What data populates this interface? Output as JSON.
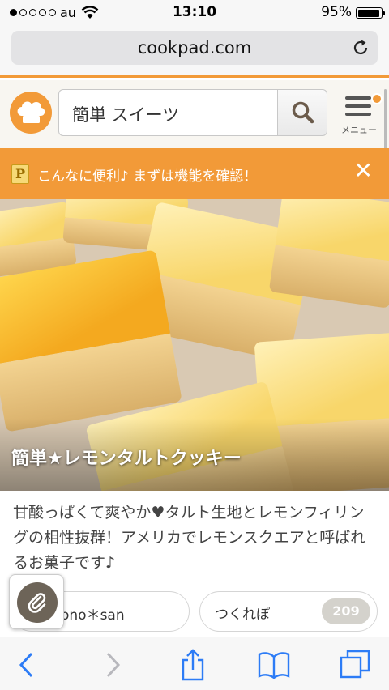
{
  "status": {
    "carrier": "au",
    "time": "13:10",
    "battery": "95%",
    "battery_level": 0.95,
    "signal_bars_filled": 1,
    "signal_bars_total": 5
  },
  "browser": {
    "url": "cookpad.com",
    "icons": [
      "reload-icon",
      "back-icon",
      "forward-icon",
      "share-icon",
      "bookmarks-icon",
      "tabs-icon"
    ]
  },
  "header": {
    "logo_icon": "chef-hat-icon",
    "search_value": "簡単 スイーツ",
    "search_icon": "search-icon",
    "menu_label": "メニュー"
  },
  "banner": {
    "text": "こんなに便利♪ まずは機能を確認！",
    "close_label": "✕"
  },
  "recipe": {
    "title": "簡単★レモンタルトクッキー",
    "description": "甘酸っぱくて爽やか♥タルト生地とレモンフィリングの相性抜群！アメリカでレモンスクエアと呼ばれるお菓子です♪",
    "author": "ono＊san",
    "tsukurepo_label": "つくれぽ",
    "tsukurepo_count": "209"
  },
  "colors": {
    "accent": "#f29a38",
    "header_bg": "#f8f6f1",
    "ios_blue": "#2d7cf6"
  }
}
